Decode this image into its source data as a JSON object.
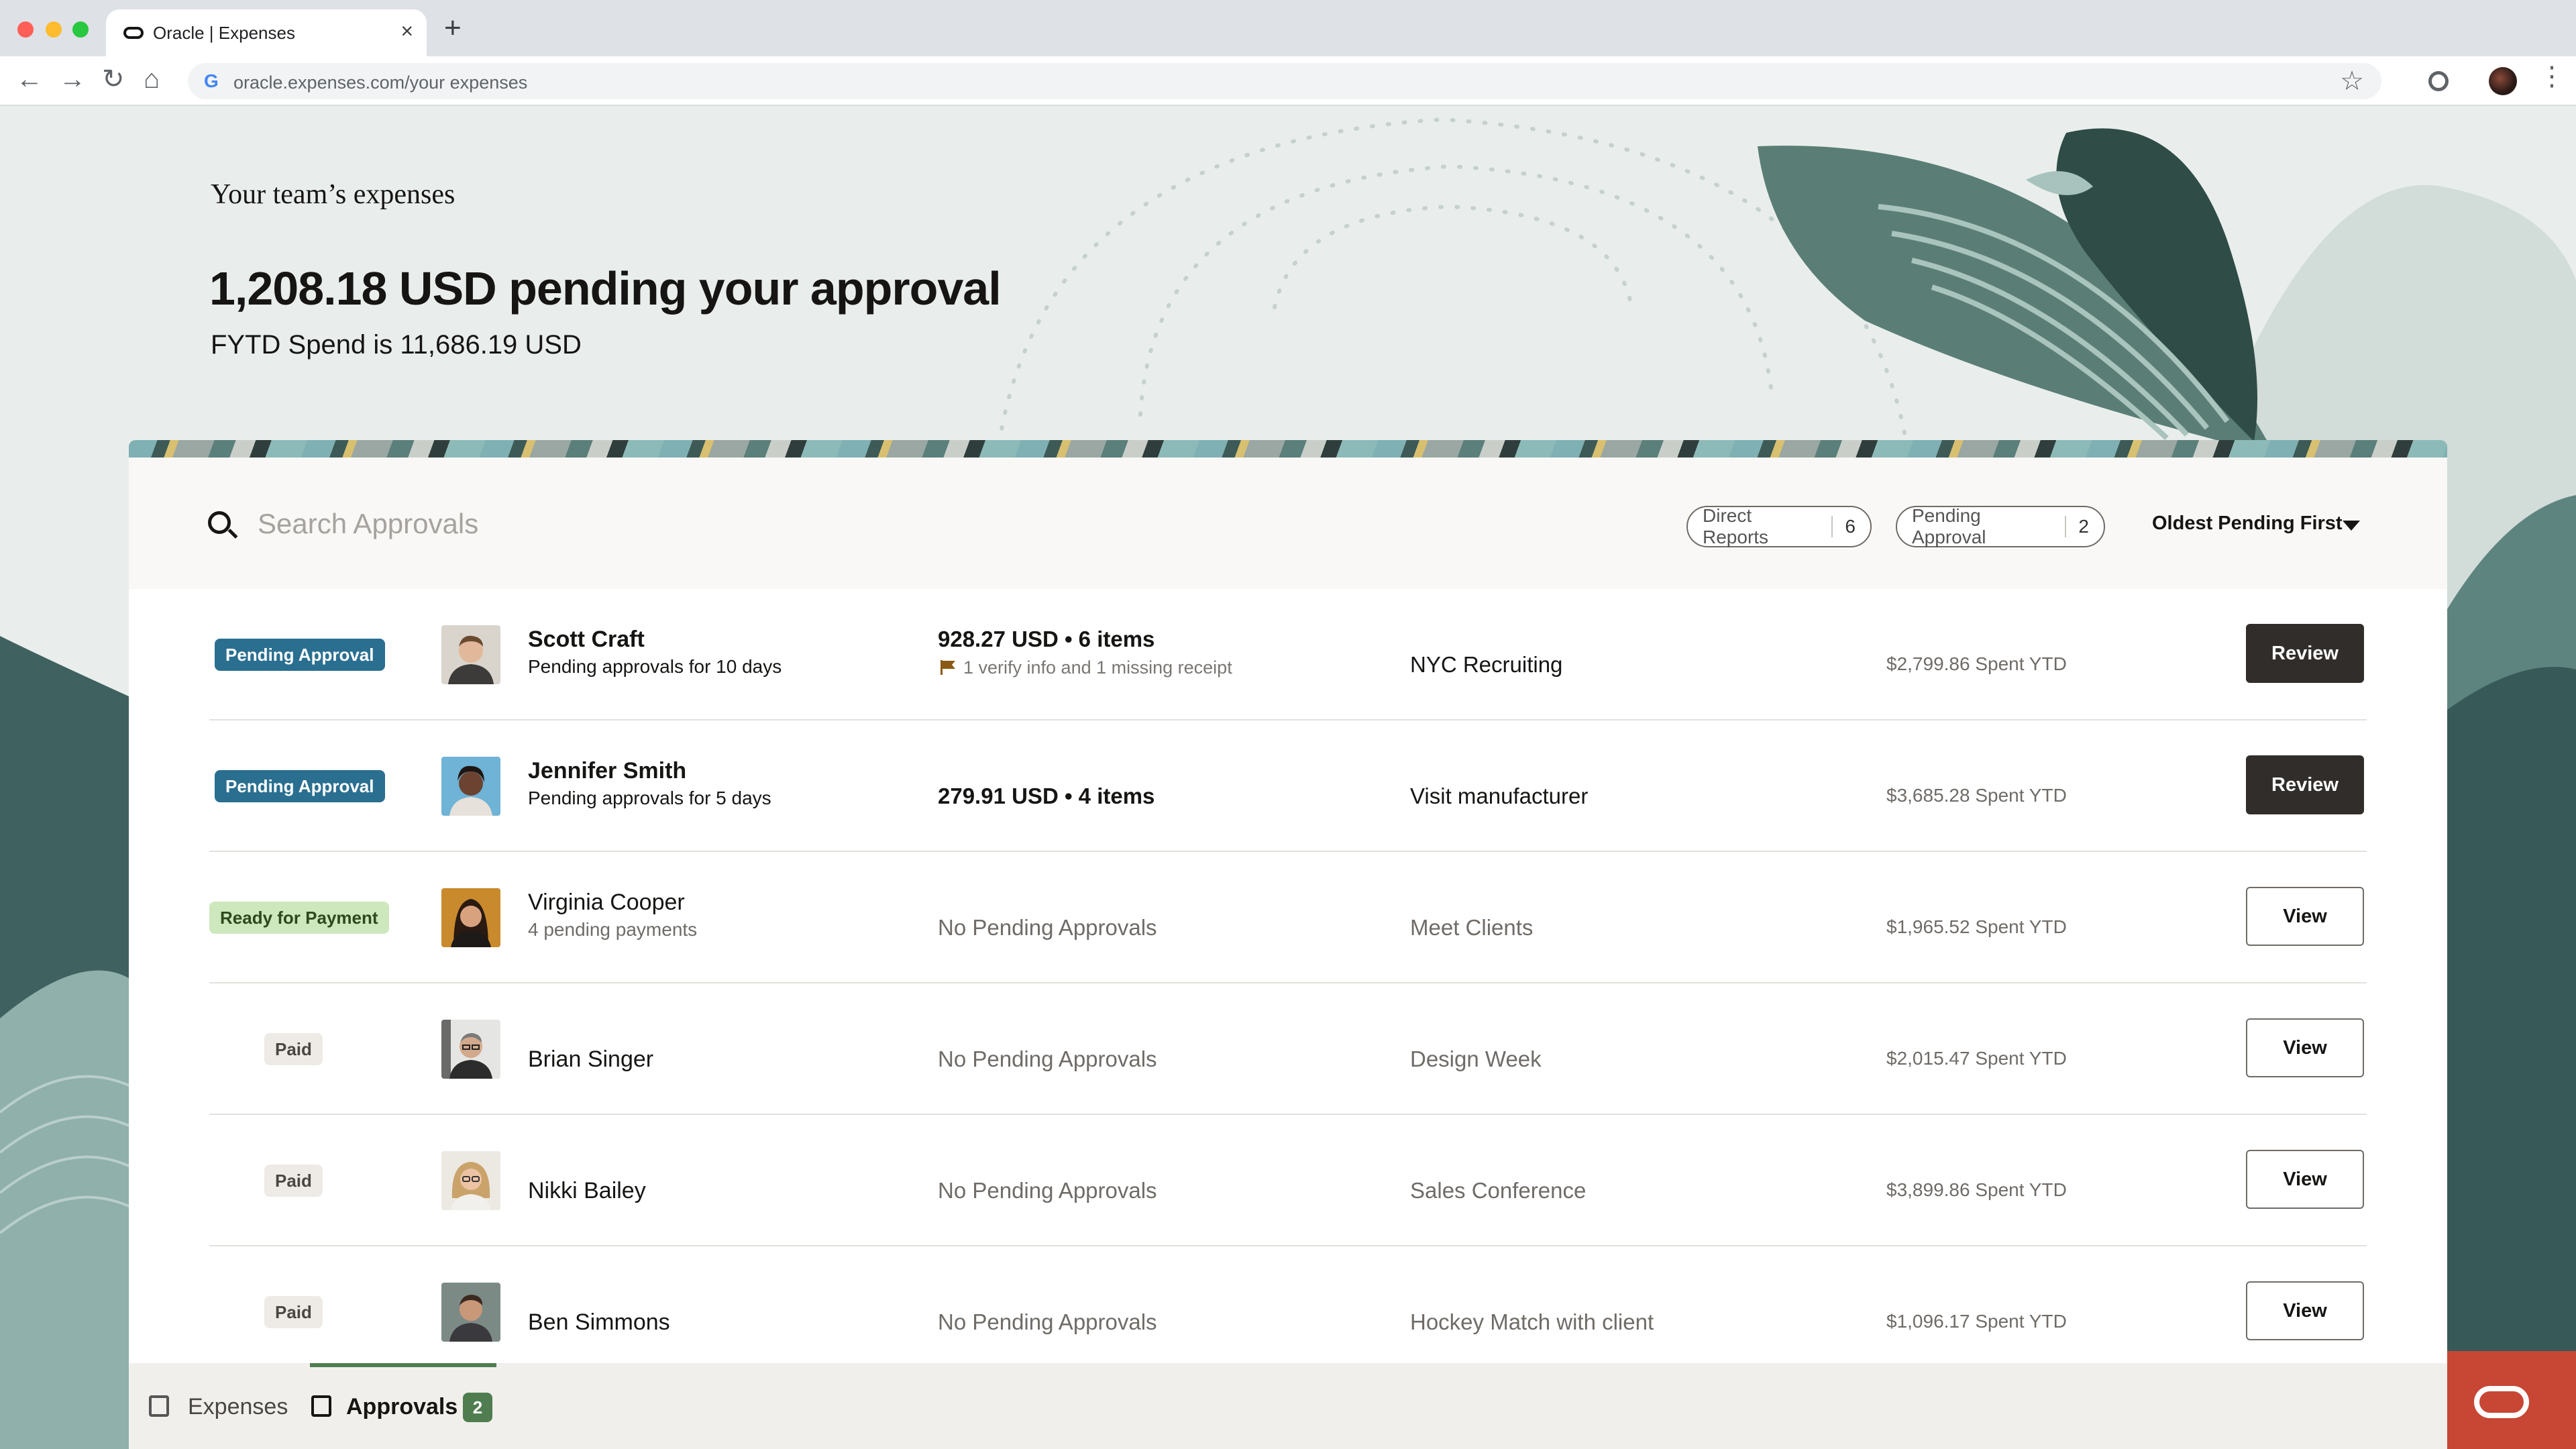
{
  "browser": {
    "tab_title": "Oracle | Expenses",
    "tab_close": "×",
    "new_tab": "+",
    "url": "oracle.expenses.com/your expenses",
    "back": "←",
    "forward": "→",
    "reload": "↻",
    "home": "⌂",
    "bookmark": "☆",
    "menu": "⋮"
  },
  "header": {
    "greeting": "Your team’s expenses",
    "pending_total": "1,208.18 USD pending your approval",
    "fytd": "FYTD Spend is 11,686.19 USD"
  },
  "search": {
    "placeholder": "Search Approvals"
  },
  "filters": [
    {
      "label": "Direct Reports",
      "count": "6"
    },
    {
      "label": "Pending Approval",
      "count": "2"
    }
  ],
  "sort": {
    "label": "Oldest Pending First"
  },
  "rows": [
    {
      "status": "Pending Approval",
      "name": "Scott Craft",
      "subtext": "Pending approvals for 10 days",
      "amount": "928.27 USD • 6 items",
      "note": "1 verify info and 1 missing receipt",
      "trip": "NYC Recruiting",
      "ytd": "$2,799.86 Spent YTD",
      "action": "Review"
    },
    {
      "status": "Pending Approval",
      "name": "Jennifer Smith",
      "subtext": "Pending approvals for 5 days",
      "amount": "279.91 USD • 4 items",
      "trip": "Visit manufacturer",
      "ytd": "$3,685.28 Spent YTD",
      "action": "Review"
    },
    {
      "status": "Ready for Payment",
      "name": "Virginia Cooper",
      "subtext": "4 pending payments",
      "amount": "No Pending Approvals",
      "trip": "Meet Clients",
      "ytd": "$1,965.52 Spent YTD",
      "action": "View"
    },
    {
      "status": "Paid",
      "name": "Brian Singer",
      "amount": "No Pending Approvals",
      "trip": "Design Week",
      "ytd": "$2,015.47 Spent YTD",
      "action": "View"
    },
    {
      "status": "Paid",
      "name": "Nikki Bailey",
      "amount": "No Pending Approvals",
      "trip": "Sales Conference",
      "ytd": "$3,899.86 Spent YTD",
      "action": "View"
    },
    {
      "status": "Paid",
      "name": "Ben Simmons",
      "amount": "No Pending Approvals",
      "trip": "Hockey Match with client",
      "ytd": "$1,096.17 Spent YTD",
      "action": "View"
    }
  ],
  "bottom_nav": {
    "expenses": "Expenses",
    "approvals": "Approvals",
    "approvals_count": "2"
  },
  "colors": {
    "pending_badge": "#2a6f90",
    "ready_badge": "#cde8bd",
    "paid_badge": "#eeebe7",
    "primary_button": "#312d2a",
    "accent_green": "#4f7d4f",
    "oracle_red": "#c74634"
  }
}
